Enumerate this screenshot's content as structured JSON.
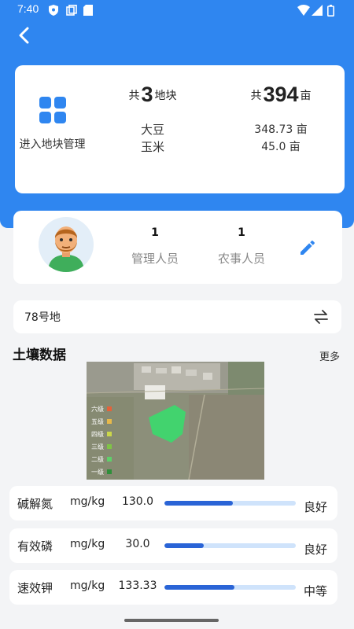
{
  "status_bar": {
    "time": "7:40"
  },
  "summary": {
    "plot_mgmt_label": "进入地块管理",
    "plots_prefix": "共",
    "plots_count": "3",
    "plots_suffix": "地块",
    "area_prefix": "共",
    "area_total": "394",
    "area_suffix": "亩",
    "crops": [
      "大豆",
      "玉米"
    ],
    "crop_areas": [
      "348.73 亩",
      "45.0 亩"
    ]
  },
  "people": {
    "managers_count": "1",
    "managers_label": "管理人员",
    "farmers_count": "1",
    "farmers_label": "农事人员"
  },
  "plot_select": {
    "current": "78号地"
  },
  "soil": {
    "title": "土壤数据",
    "more": "更多",
    "legend": [
      {
        "label": "六级",
        "color": "#e4623a"
      },
      {
        "label": "五级",
        "color": "#e8b94a"
      },
      {
        "label": "四级",
        "color": "#cbd84a"
      },
      {
        "label": "三级",
        "color": "#7fc446"
      },
      {
        "label": "二级",
        "color": "#5ed06a"
      },
      {
        "label": "一级",
        "color": "#2e8f3a"
      }
    ],
    "nutrients": [
      {
        "name": "碱解氮",
        "unit": "mg/kg",
        "value": "130.0",
        "level": 0.52,
        "grade": "良好"
      },
      {
        "name": "有效磷",
        "unit": "mg/kg",
        "value": "30.0",
        "level": 0.3,
        "grade": "良好"
      },
      {
        "name": "速效钾",
        "unit": "mg/kg",
        "value": "133.33",
        "level": 0.53,
        "grade": "中等"
      }
    ]
  },
  "colors": {
    "primary": "#2f86f0",
    "bar_fill": "#2a64d6",
    "bar_track": "#cfe3fb"
  }
}
